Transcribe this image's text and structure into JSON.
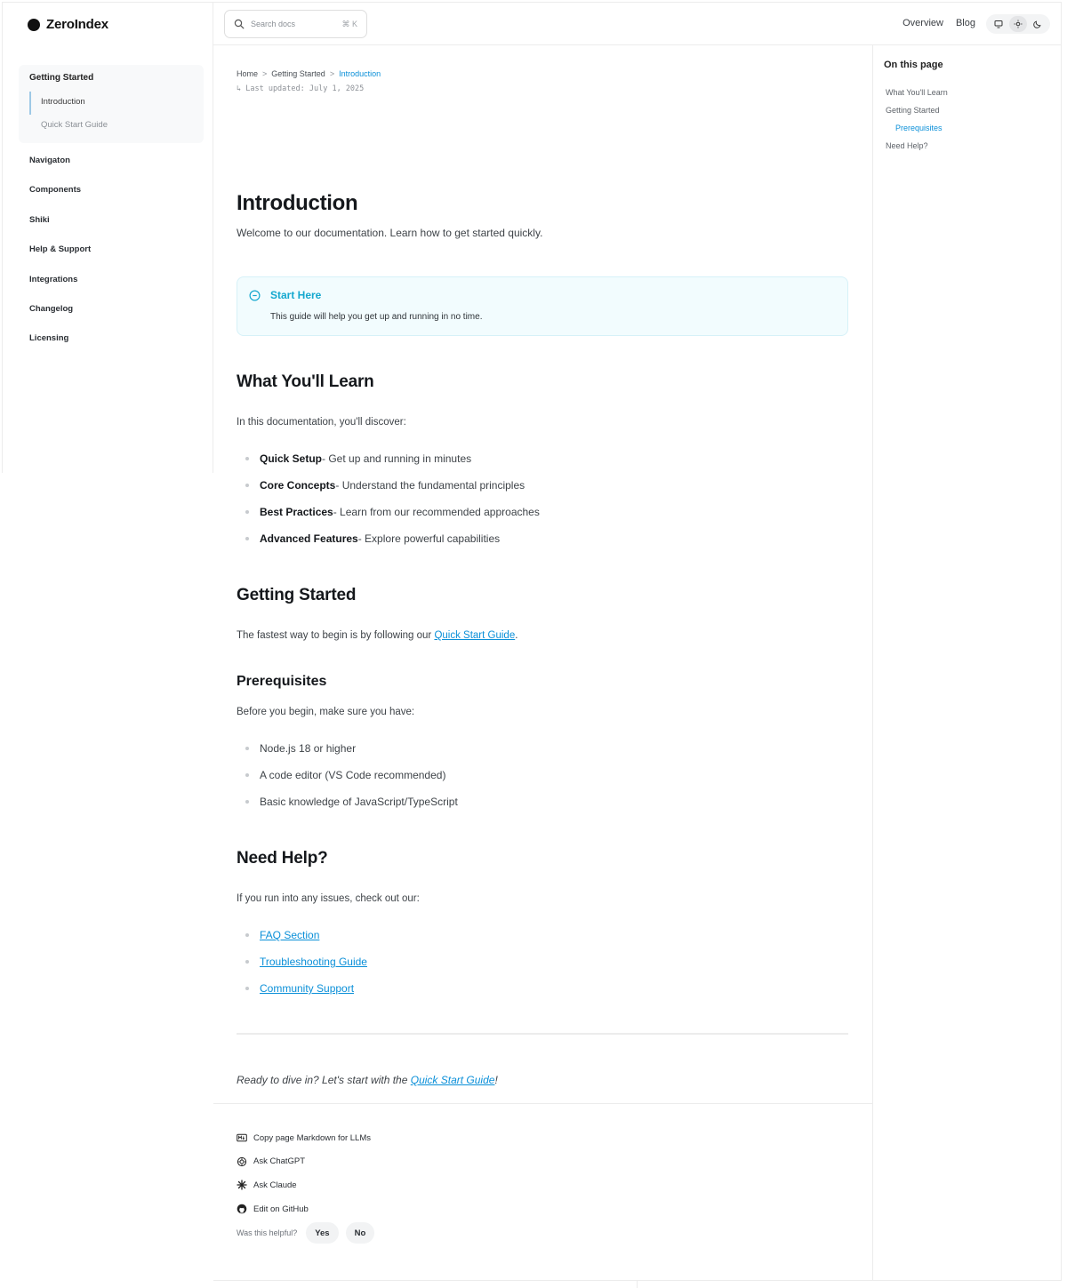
{
  "brand": {
    "name": "ZeroIndex"
  },
  "sidebar": {
    "group": {
      "title": "Getting Started",
      "items": [
        {
          "label": "Introduction"
        },
        {
          "label": "Quick Start Guide"
        }
      ]
    },
    "items": [
      {
        "label": "Navigaton"
      },
      {
        "label": "Components"
      },
      {
        "label": "Shiki"
      },
      {
        "label": "Help & Support"
      },
      {
        "label": "Integrations"
      },
      {
        "label": "Changelog"
      },
      {
        "label": "Licensing"
      }
    ]
  },
  "topbar": {
    "search_placeholder": "Search docs",
    "search_shortcut": "⌘ K",
    "links": [
      "Overview",
      "Blog"
    ]
  },
  "breadcrumb": [
    "Home",
    "Getting Started",
    "Introduction"
  ],
  "breadcrumb_sep": ">",
  "updated": "↳ Last updated: July 1, 2025",
  "page": {
    "title": "Introduction",
    "lead": "Welcome to our documentation. Learn how to get started quickly.",
    "callout": {
      "title": "Start Here",
      "body": "This guide will help you get up and running in no time."
    },
    "learn": {
      "heading": "What You'll Learn",
      "intro": "In this documentation, you'll discover:",
      "items": [
        {
          "term": "Quick Setup",
          "desc": " - Get up and running in minutes"
        },
        {
          "term": "Core Concepts",
          "desc": " - Understand the fundamental principles"
        },
        {
          "term": "Best Practices",
          "desc": " - Learn from our recommended approaches"
        },
        {
          "term": "Advanced Features",
          "desc": " - Explore powerful capabilities"
        }
      ]
    },
    "getting_started": {
      "heading": "Getting Started",
      "text": "The fastest way to begin is by following our ",
      "link": "Quick Start Guide",
      "text_end": "."
    },
    "prereq": {
      "heading": "Prerequisites",
      "intro": "Before you begin, make sure you have:",
      "items": [
        "Node.js 18 or higher",
        "A code editor (VS Code recommended)",
        "Basic knowledge of JavaScript/TypeScript"
      ]
    },
    "help": {
      "heading": "Need Help?",
      "intro": "If you run into any issues, check out our:",
      "links": [
        "FAQ Section",
        "Troubleshooting Guide",
        "Community Support"
      ]
    },
    "closing": {
      "text": "Ready to dive in? Let's start with the ",
      "link": "Quick Start Guide",
      "text_end": "!"
    }
  },
  "toc": {
    "title": "On this page",
    "items": [
      {
        "label": "What You'll Learn"
      },
      {
        "label": "Getting Started"
      },
      {
        "label": "Prerequisites"
      },
      {
        "label": "Need Help?"
      }
    ]
  },
  "footer": {
    "actions": [
      {
        "label": "Copy page Markdown for LLMs",
        "icon": "markdown-icon"
      },
      {
        "label": "Ask ChatGPT",
        "icon": "chatgpt-icon"
      },
      {
        "label": "Ask Claude",
        "icon": "claude-icon"
      },
      {
        "label": "Edit on GitHub",
        "icon": "github-icon"
      }
    ],
    "helpful": {
      "label": "Was this helpful?",
      "yes": "Yes",
      "no": "No"
    }
  },
  "colors": {
    "accent": "#0a8fd8",
    "callout_title": "#15a8cf",
    "callout_bg": "#f2fcfe"
  }
}
